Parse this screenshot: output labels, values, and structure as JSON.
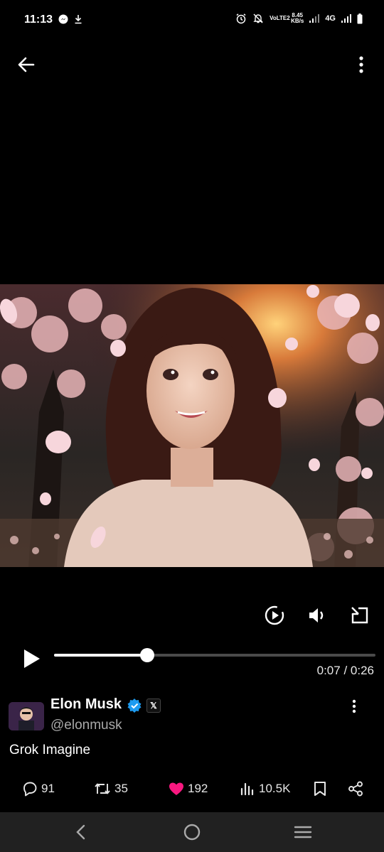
{
  "status": {
    "time": "11:13",
    "volte": "VoLTE2",
    "speed_top": "8.45",
    "speed_bottom": "KB/s",
    "network": "4G"
  },
  "player": {
    "progress_fraction": 0.29,
    "elapsed": "0:07",
    "separator": "/",
    "duration": "0:26"
  },
  "post": {
    "author_name": "Elon Musk",
    "x_badge": "𝕏",
    "handle": "@elonmusk",
    "text": "Grok Imagine"
  },
  "actions": {
    "replies": "91",
    "reposts": "35",
    "likes": "192",
    "views": "10.5K"
  },
  "colors": {
    "like": "#f91880",
    "verified": "#1d9bf0"
  },
  "icons": [
    "back-arrow-icon",
    "more-vertical-icon",
    "autoplay-icon",
    "volume-icon",
    "pip-icon",
    "play-icon",
    "reply-icon",
    "repost-icon",
    "like-icon",
    "views-icon",
    "bookmark-icon",
    "share-icon",
    "nav-back-icon",
    "nav-home-icon",
    "nav-recents-icon"
  ]
}
